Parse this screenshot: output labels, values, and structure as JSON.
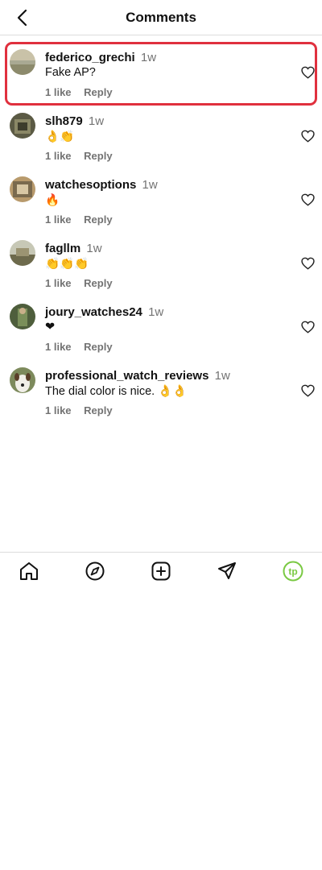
{
  "header": {
    "title": "Comments"
  },
  "comments": [
    {
      "username": "federico_grechi",
      "time": "1w",
      "text": "Fake AP?",
      "likes": "1 like",
      "reply": "Reply",
      "highlighted": true
    },
    {
      "username": "slh879",
      "time": "1w",
      "text": "👌👏",
      "likes": "1 like",
      "reply": "Reply"
    },
    {
      "username": "watchesoptions",
      "time": "1w",
      "text": "🔥",
      "likes": "1 like",
      "reply": "Reply"
    },
    {
      "username": "fagllm",
      "time": "1w",
      "text": "👏👏👏",
      "likes": "1 like",
      "reply": "Reply"
    },
    {
      "username": "joury_watches24",
      "time": "1w",
      "text": "❤",
      "likes": "1 like",
      "reply": "Reply"
    },
    {
      "username": "professional_watch_reviews",
      "time": "1w",
      "text": "The dial color is nice. 👌👌",
      "likes": "1 like",
      "reply": "Reply"
    }
  ],
  "nav": {
    "items": [
      "home-icon",
      "explore-compass-icon",
      "create-plus-icon",
      "direct-send-icon",
      "profile-avatar-icon"
    ],
    "profile_initials": "tp",
    "profile_color": "#7ac943"
  }
}
